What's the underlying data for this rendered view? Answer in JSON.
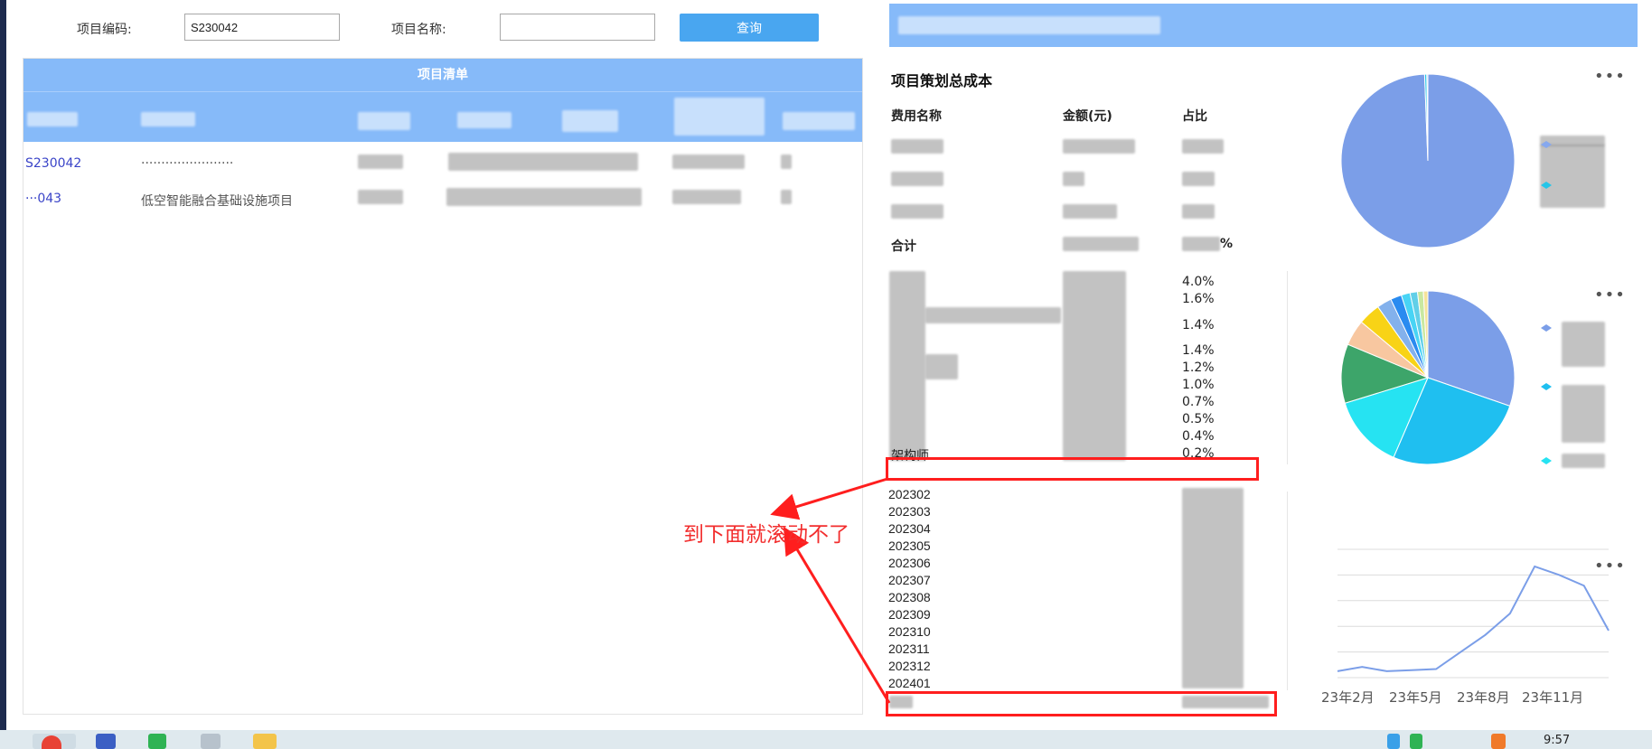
{
  "search": {
    "code_label": "项目编码:",
    "code_value": "S230042",
    "name_label": "项目名称:",
    "name_value": "",
    "query_button": "查询"
  },
  "project_list": {
    "title": "项目清单",
    "rows": [
      {
        "code": "S230042",
        "name": "·······················"
      },
      {
        "code": "···043",
        "name": "低空智能融合基础设施项目"
      }
    ]
  },
  "cost_panel": {
    "title": "项目策划总成本",
    "columns": {
      "name": "费用名称",
      "amount": "金额(元)",
      "ratio": "占比"
    },
    "total_label": "合计",
    "total_ratio_suffix": "%"
  },
  "labor_breakdown": {
    "percentages": [
      "4.0%",
      "1.6%",
      "1.4%",
      "1.4%",
      "1.2%",
      "1.0%",
      "0.7%",
      "0.5%",
      "0.4%",
      "0.2%"
    ],
    "last_role": "架构师"
  },
  "monthly": {
    "months": [
      "202302",
      "202303",
      "202304",
      "202305",
      "202306",
      "202307",
      "202308",
      "202309",
      "202310",
      "202311",
      "202312",
      "202401"
    ]
  },
  "line_chart": {
    "type": "line",
    "x_tick_labels": [
      "23年2月",
      "23年5月",
      "23年8月",
      "23年11月"
    ],
    "values": [
      3,
      5,
      3,
      3.5,
      4,
      12,
      20,
      30,
      52,
      48,
      43,
      22
    ],
    "ylim": [
      0,
      60
    ]
  },
  "pie_charts": {
    "top": {
      "type": "pie",
      "values": [
        99.4,
        0.4,
        0.2
      ],
      "colors": [
        "#7b9ee8",
        "#24c5e8",
        "#86a8ee"
      ]
    },
    "middle": {
      "type": "pie",
      "values": [
        22,
        19,
        10,
        8,
        3.5,
        3,
        2,
        1.5,
        1.2,
        1,
        0.8,
        0.6
      ],
      "colors": [
        "#7b9ee8",
        "#1fbff0",
        "#26e3f2",
        "#3da56a",
        "#f8c7a0",
        "#f8d316",
        "#83b1ec",
        "#2a8bf0",
        "#48d4f5",
        "#61cfe8",
        "#c9e8a0",
        "#f5e39a"
      ]
    }
  },
  "annotation": {
    "text": "到下面就滚动不了"
  },
  "taskbar": {
    "time": "9:57"
  },
  "menu_glyph": "•••"
}
